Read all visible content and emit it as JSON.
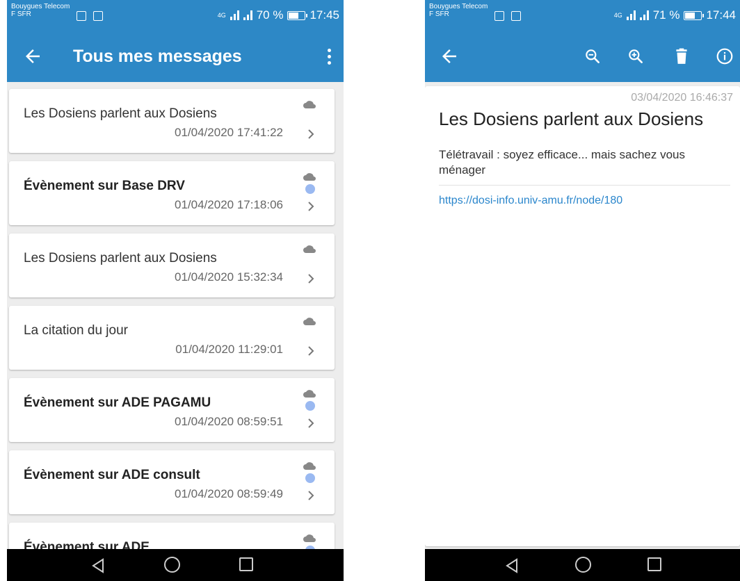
{
  "left": {
    "status": {
      "carrier_line1": "Bouygues Telecom",
      "carrier_line2": "F SFR",
      "network": "4G",
      "battery_text": "70 %",
      "battery_level": 0.7,
      "time": "17:45"
    },
    "appbar": {
      "title": "Tous mes messages",
      "back_icon": "arrow-left-icon",
      "menu_icon": "more-vert-icon"
    },
    "messages": [
      {
        "title": "Les Dosiens parlent aux Dosiens",
        "date": "01/04/2020 17:41:22",
        "unread": false
      },
      {
        "title": "Évènement sur Base DRV",
        "date": "01/04/2020 17:18:06",
        "unread": true
      },
      {
        "title": "Les Dosiens parlent aux Dosiens",
        "date": "01/04/2020 15:32:34",
        "unread": false
      },
      {
        "title": "La citation du jour",
        "date": "01/04/2020 11:29:01",
        "unread": false
      },
      {
        "title": "Évènement sur ADE PAGAMU",
        "date": "01/04/2020 08:59:51",
        "unread": true
      },
      {
        "title": "Évènement sur ADE consult",
        "date": "01/04/2020 08:59:49",
        "unread": true
      },
      {
        "title": "Évènement sur ADE",
        "date": "",
        "unread": true
      }
    ]
  },
  "right": {
    "status": {
      "carrier_line1": "Bouygues Telecom",
      "carrier_line2": "F SFR",
      "network": "4G",
      "battery_text": "71 %",
      "battery_level": 0.71,
      "time": "17:44"
    },
    "actions": [
      "arrow-left-icon",
      "zoom-out-icon",
      "zoom-in-icon",
      "trash-icon",
      "info-icon"
    ],
    "detail": {
      "date": "03/04/2020 16:46:37",
      "title": "Les Dosiens parlent aux Dosiens",
      "body": "Télétravail : soyez efficace... mais sachez vous ménager",
      "link": "https://dosi-info.univ-amu.fr/node/180"
    }
  },
  "colors": {
    "primary": "#2d88c6",
    "unread_dot": "#9ab9f1",
    "link": "#2a86cc",
    "background": "#ededed"
  }
}
